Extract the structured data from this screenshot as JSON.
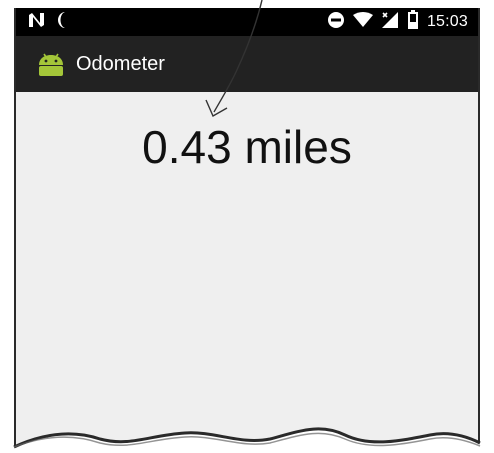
{
  "status_bar": {
    "time": "15:03",
    "left_icons": [
      "n-notification-icon",
      "moon-icon"
    ],
    "right_icons": [
      "do-not-disturb-icon",
      "wifi-icon",
      "signal-icon",
      "battery-icon"
    ]
  },
  "app_bar": {
    "title": "Odometer",
    "icon": "android-icon",
    "color": "#222222"
  },
  "main": {
    "distance_text": "0.43 miles"
  },
  "colors": {
    "status_bar": "#000000",
    "content_background": "#efefef",
    "android_green": "#a4c639"
  }
}
